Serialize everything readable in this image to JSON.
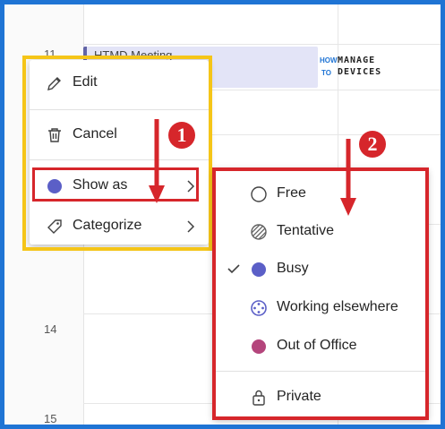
{
  "calendar": {
    "hours": [
      "11",
      "14",
      "15"
    ],
    "event": {
      "title": "HTMD Meeting",
      "accent": "#6264a7"
    }
  },
  "watermark": {
    "how": "HOW",
    "to": "TO",
    "manage": "MANAGE",
    "devices": "DEVICES"
  },
  "context_menu": {
    "items": [
      {
        "label": "Edit",
        "icon": "pencil-icon"
      },
      {
        "label": "Cancel",
        "icon": "trash-icon"
      },
      {
        "label": "Show as",
        "icon": "status-dot-icon",
        "has_submenu": true,
        "selected_color": "#5b5fc7"
      },
      {
        "label": "Categorize",
        "icon": "tag-icon",
        "has_submenu": true
      }
    ]
  },
  "show_as_menu": {
    "items": [
      {
        "label": "Free",
        "icon": "free-icon",
        "checked": false
      },
      {
        "label": "Tentative",
        "icon": "tentative-icon",
        "checked": false
      },
      {
        "label": "Busy",
        "icon": "busy-icon",
        "checked": true,
        "color": "#5b5fc7"
      },
      {
        "label": "Working elsewhere",
        "icon": "working-elsewhere-icon",
        "checked": false
      },
      {
        "label": "Out of Office",
        "icon": "out-of-office-icon",
        "checked": false,
        "color": "#b4457c"
      },
      {
        "label": "Private",
        "icon": "lock-icon",
        "checked": false
      }
    ]
  },
  "annotations": {
    "step1": "1",
    "step2": "2",
    "highlight_yellow": "#f5c518",
    "highlight_red": "#d6262b"
  }
}
